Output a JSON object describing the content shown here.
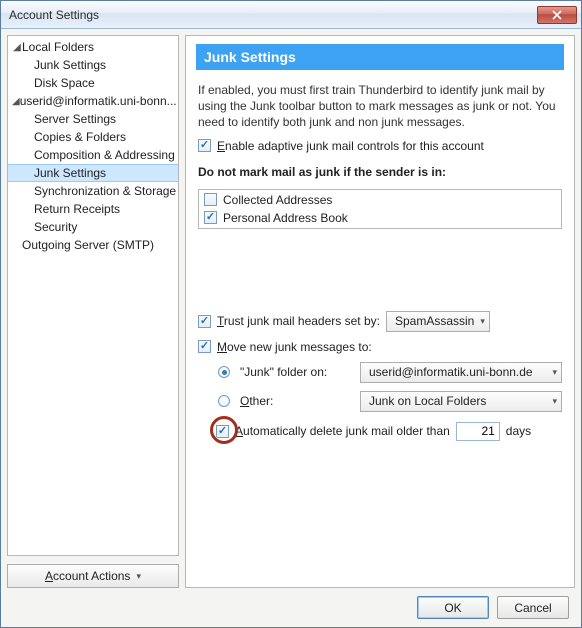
{
  "window": {
    "title": "Account Settings"
  },
  "sidebar": {
    "account_actions_label": "Account Actions",
    "items": [
      {
        "label": "Local Folders",
        "level": 0,
        "expandable": true,
        "expanded": true
      },
      {
        "label": "Junk Settings",
        "level": 1
      },
      {
        "label": "Disk Space",
        "level": 1
      },
      {
        "label": "userid@informatik.uni-bonn...",
        "level": 0,
        "expandable": true,
        "expanded": true
      },
      {
        "label": "Server Settings",
        "level": 1
      },
      {
        "label": "Copies & Folders",
        "level": 1
      },
      {
        "label": "Composition & Addressing",
        "level": 1
      },
      {
        "label": "Junk Settings",
        "level": 1,
        "selected": true
      },
      {
        "label": "Synchronization & Storage",
        "level": 1
      },
      {
        "label": "Return Receipts",
        "level": 1
      },
      {
        "label": "Security",
        "level": 1
      },
      {
        "label": "Outgoing Server (SMTP)",
        "level": 0
      }
    ]
  },
  "content": {
    "heading": "Junk Settings",
    "description": "If enabled, you must first train Thunderbird to identify junk mail by using the Junk toolbar button to mark messages as junk or not. You need to identify both junk and non junk messages.",
    "enable_label": "Enable adaptive junk mail controls for this account",
    "enable_checked": true,
    "whitelist_heading": "Do not mark mail as junk if the sender is in:",
    "whitelist": [
      {
        "label": "Collected Addresses",
        "checked": false
      },
      {
        "label": "Personal Address Book",
        "checked": true
      }
    ],
    "trust_label_pre": "T",
    "trust_label_rest": "rust junk mail headers set by:",
    "trust_checked": true,
    "trust_value": "SpamAssassin",
    "move_label_pre": "M",
    "move_label_rest": "ove new junk messages to:",
    "move_checked": true,
    "dest": {
      "junk_label": "\"Junk\" folder on:",
      "junk_value": "userid@informatik.uni-bonn.de",
      "other_label_pre": "O",
      "other_label_rest": "ther:",
      "other_value": "Junk on Local Folders",
      "selected": "junk"
    },
    "autodelete": {
      "label_pre": "A",
      "label_rest": "utomatically delete junk mail older than",
      "checked": true,
      "days": "21",
      "days_suffix": "days"
    }
  },
  "footer": {
    "ok": "OK",
    "cancel": "Cancel"
  }
}
